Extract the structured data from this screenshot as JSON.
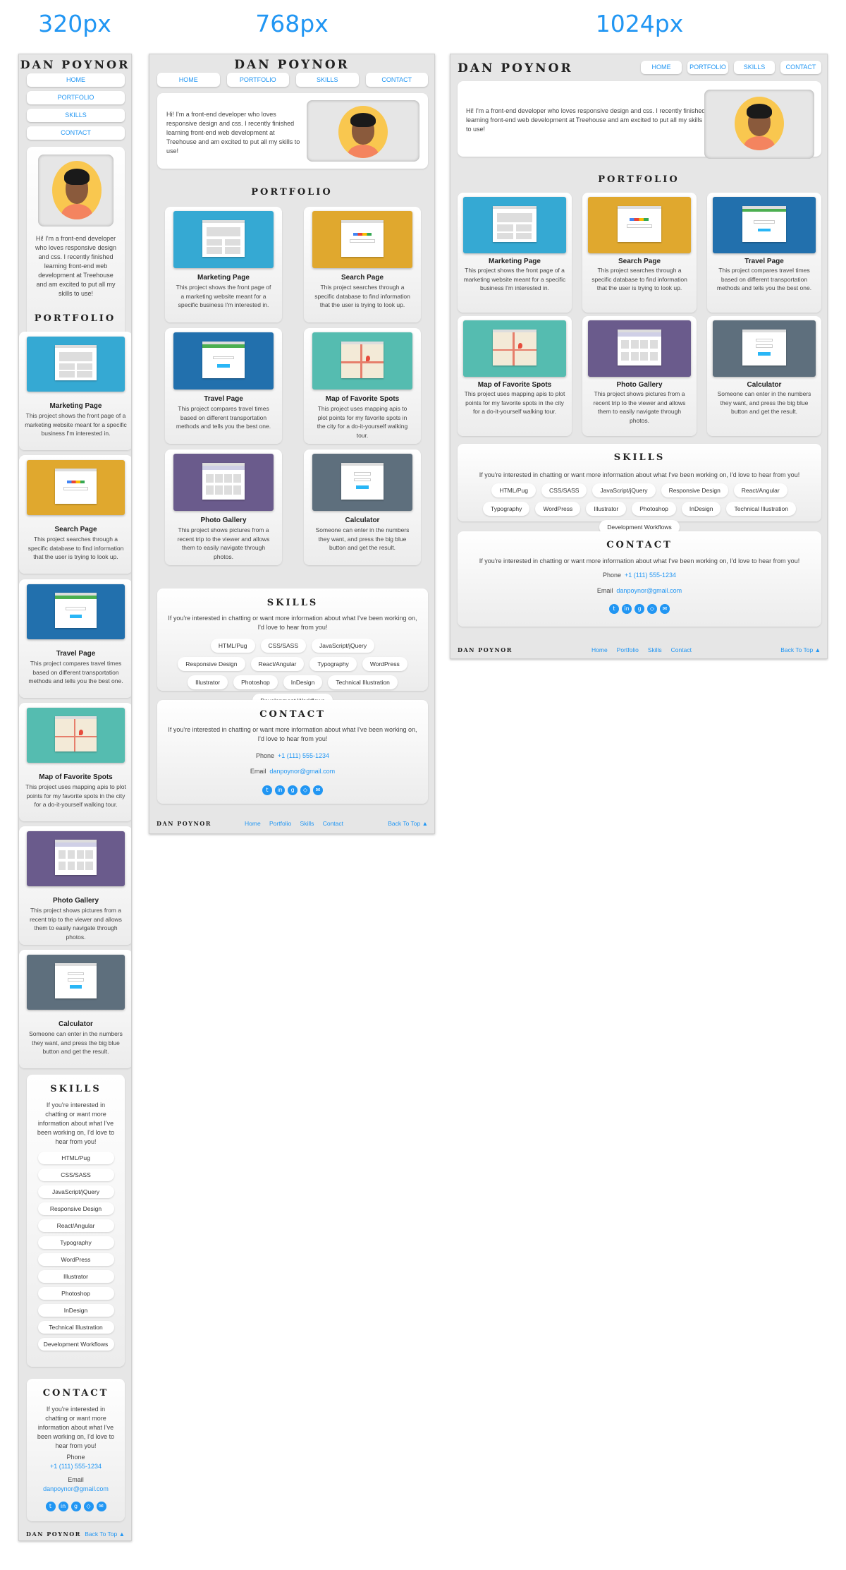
{
  "labels": [
    "320px",
    "768px",
    "1024px"
  ],
  "brand": "DAN POYNOR",
  "nav": [
    "HOME",
    "PORTFOLIO",
    "SKILLS",
    "CONTACT"
  ],
  "about": "Hi! I'm a front-end developer who loves responsive design and css. I recently finished learning front-end web development at Treehouse and am excited to put all my skills to use!",
  "portfolio": {
    "title": "PORTFOLIO",
    "items": [
      {
        "name": "Marketing Page",
        "desc": "This project shows the front page of a marketing website meant for a specific business I'm interested in.",
        "color": "#35a9d3",
        "kind": "grid"
      },
      {
        "name": "Search Page",
        "desc": "This project searches through a specific database to find information that the user is trying to look up.",
        "color": "#e0a82e",
        "kind": "search"
      },
      {
        "name": "Travel Page",
        "desc": "This project compares travel times based on different transportation methods and tells you the best one.",
        "color": "#2270ad",
        "kind": "form"
      },
      {
        "name": "Map of Favorite Spots",
        "desc": "This project uses mapping apis to plot points for my favorite spots in the city for a do-it-yourself walking tour.",
        "color": "#55bcb0",
        "kind": "map"
      },
      {
        "name": "Photo Gallery",
        "desc": "This project shows pictures from a recent trip to the viewer and allows them to easily navigate through photos.",
        "color": "#6a5b8c",
        "kind": "gallery"
      },
      {
        "name": "Calculator",
        "desc": "Someone can enter in the numbers they want, and press the big blue button and get the result.",
        "color": "#5e6f7d",
        "kind": "calc"
      }
    ]
  },
  "skills": {
    "title": "SKILLS",
    "intro": "If you're interested in chatting or want more information about what I've been working on, I'd love to hear from you!",
    "list": [
      "HTML/Pug",
      "CSS/SASS",
      "JavaScript/jQuery",
      "Responsive Design",
      "React/Angular",
      "Typography",
      "WordPress",
      "Illustrator",
      "Photoshop",
      "InDesign",
      "Technical Illustration",
      "Development Workflows"
    ]
  },
  "contact": {
    "title": "CONTACT",
    "intro": "If you're interested in chatting or want more information about what I've been working on, I'd love to hear from you!",
    "phone_label": "Phone",
    "phone": "+1 (111) 555-1234",
    "email_label": "Email",
    "email": "danpoynor@gmail.com",
    "social": [
      "twitter-icon",
      "linkedin-icon",
      "github-icon",
      "codepen-icon",
      "mail-icon"
    ]
  },
  "footer": {
    "brand": "DAN POYNOR",
    "links": [
      "Home",
      "Portfolio",
      "Skills",
      "Contact"
    ],
    "back": "Back To Top ▲"
  },
  "colors": {
    "accent": "#2196f3",
    "frame_bg": "#e6e6e6"
  }
}
